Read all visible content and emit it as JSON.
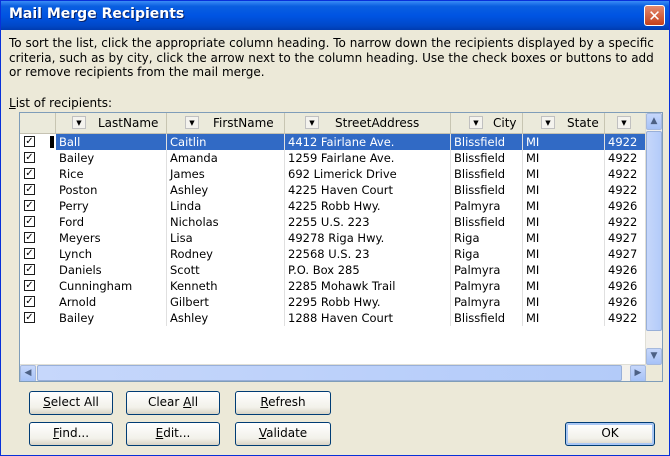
{
  "window": {
    "title": "Mail Merge Recipients",
    "close_glyph": "✕"
  },
  "description": "To sort the list, click the appropriate column heading.  To narrow down the recipients displayed by a specific criteria, such as by city, click the arrow next to the column heading.  Use the check boxes or buttons to add or remove recipients from the mail merge.",
  "list_label": {
    "prefix": "L",
    "rest": "ist of recipients:"
  },
  "columns": [
    "LastName",
    "FirstName",
    "StreetAddress",
    "City",
    "State",
    ""
  ],
  "rows": [
    {
      "last": "Ball",
      "first": "Caitlin",
      "street": "4412 Fairlane Ave.",
      "city": "Blissfield",
      "state": "MI",
      "zip": "4922",
      "checked": true,
      "selected": true
    },
    {
      "last": "Bailey",
      "first": "Amanda",
      "street": "1259 Fairlane Ave.",
      "city": "Blissfield",
      "state": "MI",
      "zip": "4922",
      "checked": true
    },
    {
      "last": "Rice",
      "first": "James",
      "street": "692 Limerick Drive",
      "city": "Blissfield",
      "state": "MI",
      "zip": "4922",
      "checked": true
    },
    {
      "last": "Poston",
      "first": "Ashley",
      "street": "4225 Haven Court",
      "city": "Blissfield",
      "state": "MI",
      "zip": "4922",
      "checked": true
    },
    {
      "last": "Perry",
      "first": "Linda",
      "street": "4225 Robb Hwy.",
      "city": "Palmyra",
      "state": "MI",
      "zip": "4926",
      "checked": true
    },
    {
      "last": "Ford",
      "first": "Nicholas",
      "street": "2255 U.S. 223",
      "city": "Blissfield",
      "state": "MI",
      "zip": "4922",
      "checked": true
    },
    {
      "last": "Meyers",
      "first": "Lisa",
      "street": "49278 Riga Hwy.",
      "city": "Riga",
      "state": "MI",
      "zip": "4927",
      "checked": true
    },
    {
      "last": "Lynch",
      "first": "Rodney",
      "street": "22568 U.S. 23",
      "city": "Riga",
      "state": "MI",
      "zip": "4927",
      "checked": true
    },
    {
      "last": "Daniels",
      "first": "Scott",
      "street": "P.O. Box 285",
      "city": "Palmyra",
      "state": "MI",
      "zip": "4926",
      "checked": true
    },
    {
      "last": "Cunningham",
      "first": "Kenneth",
      "street": "2285 Mohawk Trail",
      "city": "Palmyra",
      "state": "MI",
      "zip": "4926",
      "checked": true
    },
    {
      "last": "Arnold",
      "first": "Gilbert",
      "street": "2295 Robb Hwy.",
      "city": "Palmyra",
      "state": "MI",
      "zip": "4926",
      "checked": true
    },
    {
      "last": "Bailey",
      "first": "Ashley",
      "street": "1288 Haven Court",
      "city": "Blissfield",
      "state": "MI",
      "zip": "4922",
      "checked": true
    }
  ],
  "buttons": {
    "select_all": {
      "u": "S",
      "rest": "elect All"
    },
    "clear_all": {
      "pre": "Clear ",
      "u": "A",
      "rest": "ll"
    },
    "refresh": {
      "u": "R",
      "rest": "efresh"
    },
    "find": {
      "u": "F",
      "rest": "ind..."
    },
    "edit": {
      "u": "E",
      "rest": "dit..."
    },
    "validate": {
      "u": "V",
      "rest": "alidate"
    },
    "ok": "OK"
  },
  "colors": {
    "selection": "#316ac5",
    "titlebar": "#0054e3"
  }
}
